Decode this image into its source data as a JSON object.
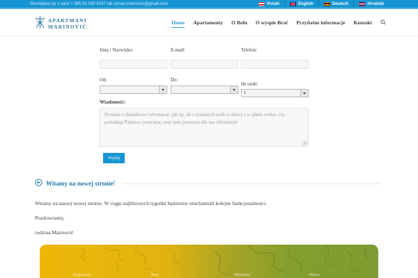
{
  "topbar": {
    "contact_text": "Skontaktuj się z nami + 385 91 530 4237 lub roman.marinovic@gmail.com",
    "languages": [
      {
        "label": "Polski"
      },
      {
        "label": "English"
      },
      {
        "label": "Deutsch"
      },
      {
        "label": "Hrvatski"
      }
    ]
  },
  "header": {
    "logo_line1": "APARTMANI",
    "logo_line2": "MARINOVIĆ",
    "nav": [
      {
        "label": "Home",
        "active": true
      },
      {
        "label": "Apartamenty",
        "active": false
      },
      {
        "label": "O Bolu",
        "active": false
      },
      {
        "label": "O wyspie Brač",
        "active": false
      },
      {
        "label": "Przydatne informacje",
        "active": false
      },
      {
        "label": "Kontakt",
        "active": false
      }
    ]
  },
  "form": {
    "name_label": "Imię i Nazwisko:",
    "email_label": "E-mail:",
    "phone_label": "Telefon:",
    "from_label": "Od:",
    "to_label": "Do:",
    "persons_label": "Ile osób:",
    "persons_value": "1",
    "message_label": "Wiadomość:",
    "message_placeholder": "Prosimy o dodatkowe informacje, jak np. ile z podanych osób to dzieci i w jakim wieku, czy posiadają Państwo zwierzęta, oraz inne pomocne dla nas informacje",
    "submit_label": "Wyślij"
  },
  "welcome": {
    "title": "Witamy na nowej stronie!",
    "paragraphs": [
      "Witamy na naszej nowej stronie. W ciągu najbliższych tygodni będziemy uruchamiali kolejne funkcjonalności.",
      "Pozdrawiamy,",
      "rodzina Marinović"
    ]
  },
  "map": {
    "labels": [
      "Rogoznica",
      "Brač",
      "Makarska",
      "Ričice"
    ]
  },
  "colors": {
    "topbar_blue": "#1795d3",
    "accent_blue": "#2176ae",
    "logo_blue": "#31789f",
    "button_blue": "#1795d3",
    "map_yellow": "#eeb70a",
    "map_green": "#7d9c31"
  }
}
